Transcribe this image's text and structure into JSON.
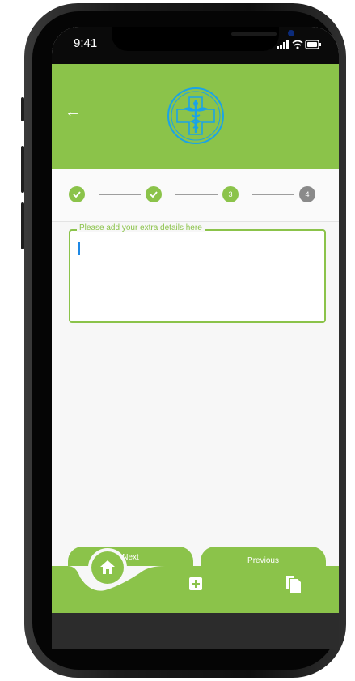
{
  "status_bar": {
    "time": "9:41",
    "indicators": "▐▐ ◠ ▬"
  },
  "header": {
    "back_icon": "arrow-left-icon",
    "logo_icon": "medical-caduceus-icon",
    "colors": {
      "green": "#8bc34a",
      "logo_blue": "#1aa3e8"
    }
  },
  "stepper": {
    "steps": [
      {
        "state": "done",
        "label": ""
      },
      {
        "state": "done",
        "label": ""
      },
      {
        "state": "active",
        "label": "3"
      },
      {
        "state": "pending",
        "label": "4"
      }
    ]
  },
  "details_field": {
    "label": "Please add your extra details here",
    "value": ""
  },
  "actions": {
    "next_label": "Next",
    "previous_label": "Previous"
  },
  "bottom_nav": {
    "items": [
      "home-icon",
      "add-box-icon",
      "documents-icon"
    ]
  }
}
